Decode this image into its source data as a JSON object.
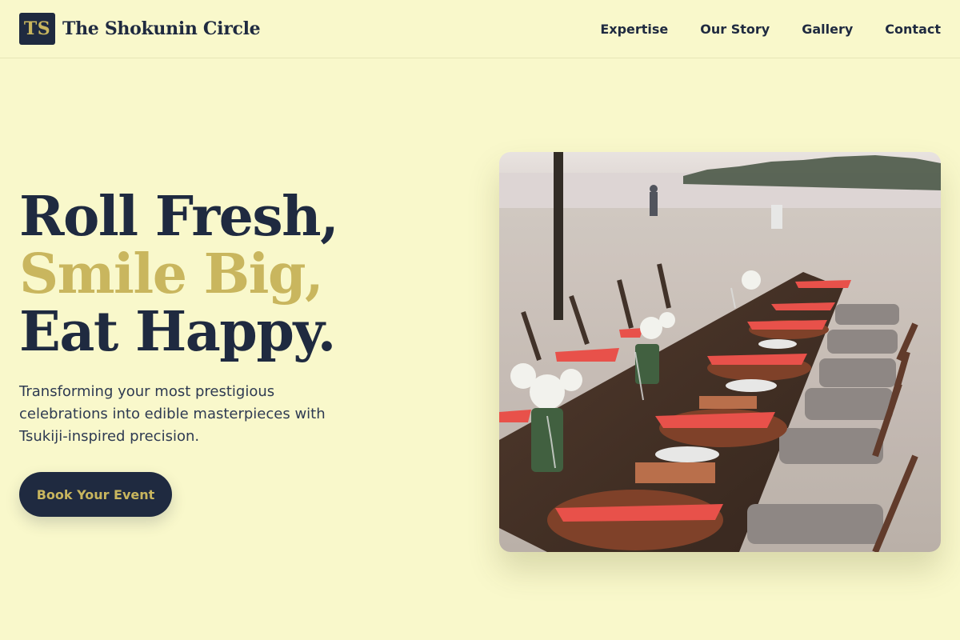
{
  "header": {
    "logo_text": "TS",
    "brand_name": "The Shokunin Circle",
    "nav": [
      "Expertise",
      "Our Story",
      "Gallery",
      "Contact"
    ]
  },
  "hero": {
    "title_line1": "Roll Fresh,",
    "title_line2": "Smile Big,",
    "title_line3": "Eat Happy.",
    "subtitle": "Transforming your most prestigious celebrations into edible masterpieces with Tsukiji-inspired precision.",
    "cta_label": "Book Your Event",
    "image_alt": "Beach dinner table set with red napkins and rattan placemats"
  },
  "colors": {
    "background": "#f9f8cb",
    "navy": "#1f2a40",
    "gold": "#c9b65e"
  }
}
